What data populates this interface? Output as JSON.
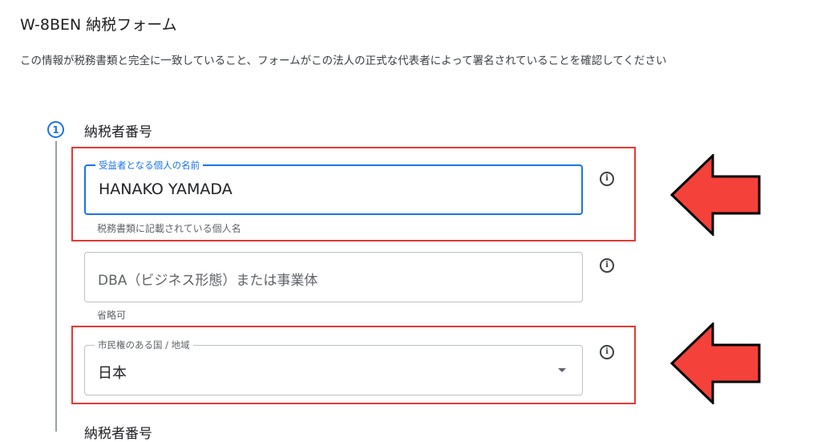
{
  "header": {
    "title": "W-8BEN 納税フォーム",
    "description": "この情報が税務書類と完全に一致していること、フォームがこの法人の正式な代表者によって署名されていることを確認してください"
  },
  "step": {
    "number": "1",
    "title": "納税者番号"
  },
  "fields": {
    "beneficiary_name": {
      "label": "受益者となる個人の名前",
      "value": "HANAKO YAMADA",
      "helper": "税務書類に記載されている個人名"
    },
    "dba": {
      "placeholder": "DBA（ビジネス形態）または事業体",
      "helper": "省略可"
    },
    "citizenship": {
      "label": "市民権のある国 / 地域",
      "value": "日本"
    }
  },
  "icons": {
    "info": "info-icon",
    "dropdown": "dropdown-arrow-icon",
    "annotation": "red-arrow-left-icon"
  },
  "next_section": {
    "title": "納税者番号"
  },
  "colors": {
    "accent": "#1a73e8",
    "annotation": "#e53935",
    "annotation_fill": "#f4413a"
  }
}
